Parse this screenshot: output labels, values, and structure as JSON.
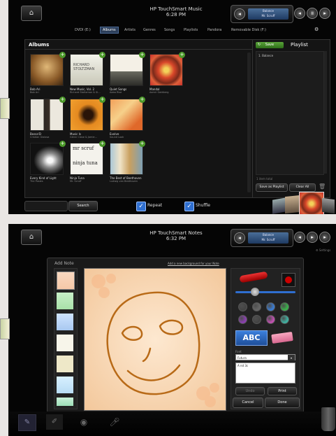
{
  "music": {
    "app_title": "HP TouchSmart Music",
    "time": "6:28 PM",
    "now_playing": {
      "track": "Balance",
      "artist": "Mr. Scruff"
    },
    "tabs": [
      "DVDI (E:)",
      "Albums",
      "Artists",
      "Genres",
      "Songs",
      "Playlists",
      "Pandora",
      "Removable Disk (F:)"
    ],
    "selected_tab": "Albums",
    "albums_header": "Albums",
    "albums": [
      {
        "title": "Bob Ari",
        "artist": "Bob Ari"
      },
      {
        "title": "New Music, Vol. 2",
        "artist": "Richard Stoltzman & Si..."
      },
      {
        "title": "Quiet Songs",
        "artist": "Aoba Rise"
      },
      {
        "title": "Mandal",
        "artist": "Aamir Goldberg"
      },
      {
        "title": "Bossa'D",
        "artist": "Cristian Gioiosa"
      },
      {
        "title": "Music Is",
        "artist": "Glenn Close & Jamie..."
      },
      {
        "title": "Evolve",
        "artist": "Sound Look"
      },
      {
        "title": "Every Kind of Light",
        "artist": "The Posies"
      },
      {
        "title": "Ninja Tuna",
        "artist": "Mr. Scruff"
      },
      {
        "title": "The Best of Beethoven",
        "artist": "Ludwig van Beethoven"
      }
    ],
    "playlist": {
      "title": "Playlist",
      "save_label": "Save",
      "items": [
        "1. Balance"
      ],
      "count": "1 item total"
    },
    "save_as_playlist": "Save as Playlist",
    "clear_all": "Clear All",
    "search_label": "Search",
    "repeat_label": "Repeat",
    "shuffle_label": "Shuffle"
  },
  "notes": {
    "app_title": "HP TouchSmart Notes",
    "time": "6:32 PM",
    "now_playing": {
      "track": "Balance",
      "artist": "Mr. Scruff"
    },
    "settings_label": "Settings",
    "add_note_title": "Add Note",
    "background_link": "Add a new background for your Note",
    "text_tool": "ABC",
    "font_label": "Font",
    "font_value": "Futura",
    "size_value": "A nd 3c",
    "undo_label": "Undo",
    "print_label": "Print",
    "cancel_label": "Cancel",
    "done_label": "Done",
    "swatch_colors": [
      "#444444",
      "#666666",
      "#3a7bd0",
      "#3ab04a",
      "#8a3fb0",
      "#444444",
      "#c04fb0",
      "#3fb0a0"
    ],
    "canvas_bg": "#f6d7b3",
    "ink_color": "#b86a17"
  }
}
